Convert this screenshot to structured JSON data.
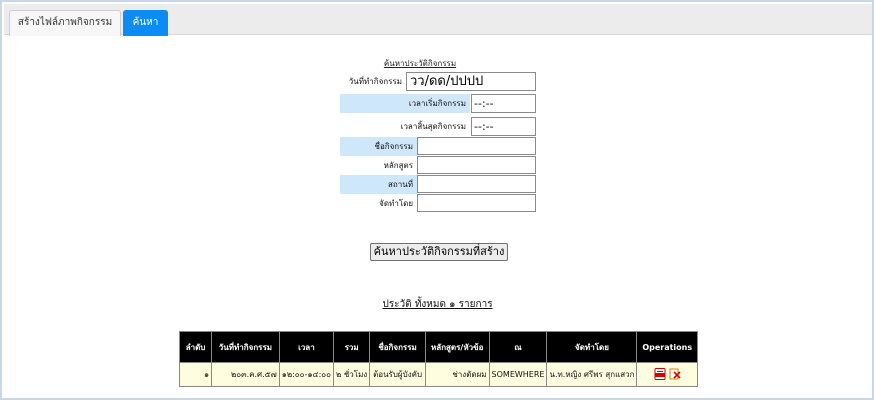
{
  "tabs": [
    {
      "label": "สร้างไฟล์ภาพกิจกรรม"
    },
    {
      "label": "ค้นหา"
    }
  ],
  "form": {
    "title": "ค้นหาประวัติกิจกรรม",
    "fields": {
      "date": {
        "label": "วันที่ทำกิจกรรม",
        "value": "วว/ดด/ปปปป"
      },
      "start": {
        "label": "เวลาเริ่มกิจกรรม",
        "value": "--:--"
      },
      "end": {
        "label": "เวลาสิ้นสุดกิจกรรม",
        "value": "--:--"
      },
      "name": {
        "label": "ชื่อกิจกรรม",
        "value": ""
      },
      "course": {
        "label": "หลักสูตร",
        "value": ""
      },
      "place": {
        "label": "สถานที่",
        "value": ""
      },
      "organizer": {
        "label": "จัดทำโดย",
        "value": ""
      }
    },
    "submit_label": "ค้นหาประวัติกิจกรรมที่สร้าง"
  },
  "summary": "ประวัติ ทั้งหมด ๑ รายการ",
  "table": {
    "headers": [
      "ลำดับ",
      "วันที่ทำกิจกรรม",
      "เวลา",
      "รวม",
      "ชื่อกิจกรรม",
      "หลักสูตร/หัวข้อ",
      "ณ",
      "จัดทำโดย",
      "Operations"
    ],
    "rows": [
      [
        "๑",
        "๒๐๓.ค.ศ.๕๗",
        "๑๒:๐๐-๑๔:๐๐",
        "๒ ชั่วโมง",
        "ต้อนรับผู้บังคับ",
        "ช่างตัดผม",
        "SOMEWHERE",
        "น.ท.หญิง ศรีพร สุกแสวก"
      ]
    ]
  },
  "icons": {
    "pdf": "pdf-icon",
    "delete": "delete-icon"
  },
  "colors": {
    "tab_active": "#0b8cf2",
    "label_highlight": "#cfe7fb",
    "row_bg": "#fffde0",
    "header_bg": "#000000"
  }
}
